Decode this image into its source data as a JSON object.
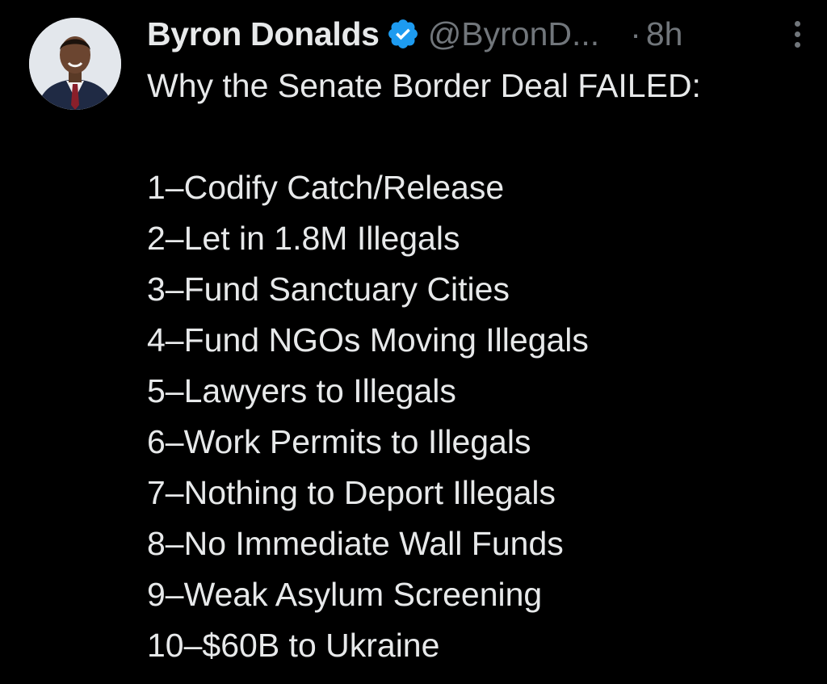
{
  "author": {
    "display_name": "Byron Donalds",
    "handle": "@ByronD...",
    "time": "8h",
    "separator": "·"
  },
  "tweet": {
    "intro": "Why the Senate Border Deal FAILED:",
    "items": [
      "1–Codify Catch/Release",
      "2–Let in 1.8M Illegals",
      "3–Fund Sanctuary Cities",
      "4–Fund NGOs Moving Illegals",
      "5–Lawyers to Illegals",
      "6–Work Permits to Illegals",
      "7–Nothing to Deport Illegals",
      "8–No Immediate Wall Funds",
      "9–Weak Asylum Screening",
      "10–$60B to Ukraine"
    ]
  },
  "icons": {
    "verified": "verified-badge-icon",
    "more": "more-options-icon"
  },
  "colors": {
    "background": "#000000",
    "text": "#e7e9ea",
    "secondary": "#71767b",
    "verified": "#1d9bf0"
  }
}
